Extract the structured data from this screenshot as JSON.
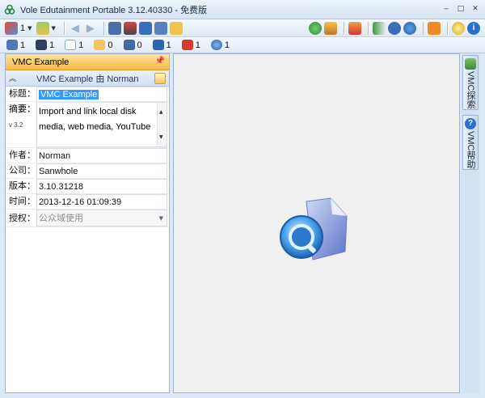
{
  "window": {
    "title": "Vole Edutainment Portable   3.12.40330 - 免费版",
    "controls": [
      "‒",
      "□",
      "✕"
    ]
  },
  "toolbar1": {
    "items": [
      {
        "icon": "users-icon",
        "count": "1"
      },
      {
        "icon": "disk-icon",
        "count": ""
      }
    ]
  },
  "toolbar2": {
    "items": [
      {
        "icon": "screen-icon",
        "count": "1"
      },
      {
        "icon": "film-icon",
        "count": "1"
      },
      {
        "icon": "document-icon",
        "count": "1"
      },
      {
        "icon": "folder-icon",
        "count": "0"
      },
      {
        "icon": "monitor-web-icon",
        "count": "0"
      },
      {
        "icon": "monitor-save-icon",
        "count": "1"
      },
      {
        "icon": "youtube-icon",
        "count": "1"
      },
      {
        "icon": "globe-icon",
        "count": "1"
      }
    ]
  },
  "left_panel": {
    "header": "VMC Example",
    "pin": "ᵖ",
    "sub_header": "VMC Example 由 Norman",
    "fields": {
      "title_label": "标题：",
      "title_value": "VMC Example",
      "summary_label": "摘要：",
      "version_badge": "v 3.2",
      "summary_line1": "Import and link local disk",
      "summary_line2": "media, web media, YouTube",
      "author_label": "作者：",
      "author_value": "Norman",
      "company_label": "公司：",
      "company_value": "Sanwhole",
      "version_label": "版本：",
      "version_value": "3.10.31218",
      "time_label": "时间：",
      "time_value": "2013-12-16 01:09:39",
      "license_label": "授权：",
      "license_value": "公众域使用"
    }
  },
  "right_sidebar": {
    "tabs": [
      "VMC探索",
      "VMC帮助"
    ]
  }
}
